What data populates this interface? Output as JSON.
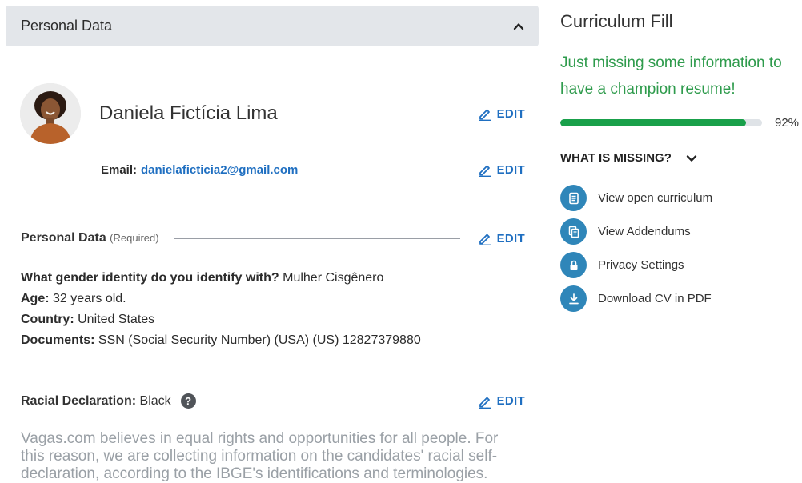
{
  "personal_section": {
    "header": "Personal Data",
    "collapse_icon": "chevron-up-icon"
  },
  "profile": {
    "name": "Daniela Fictícia Lima",
    "edit_label": "EDIT",
    "email_label": "Email:",
    "email_value": "danielaficticia2@gmail.com"
  },
  "personal_data": {
    "title": "Personal Data",
    "required": "(Required)",
    "edit_label": "EDIT",
    "fields": [
      {
        "label": "What gender identity do you identify with?",
        "value": "Mulher Cisgênero"
      },
      {
        "label": "Age:",
        "value": "32 years old."
      },
      {
        "label": "Country:",
        "value": "United States"
      },
      {
        "label": "Documents:",
        "value": "SSN (Social Security Number) (USA) (US) 12827379880"
      }
    ]
  },
  "racial": {
    "label": "Racial Declaration:",
    "value": "Black",
    "help": "?",
    "edit_label": "EDIT",
    "description": "Vagas.com believes in equal rights and opportunities for all people. For this reason, we are collecting information on the candidates' racial self-declaration, according to the IBGE's identifications and terminologies."
  },
  "curriculum": {
    "title": "Curriculum Fill",
    "message": "Just missing some information to have a champion resume!",
    "progress_value": 92,
    "progress_text": "92%",
    "missing_label": "WHAT IS MISSING?",
    "actions": [
      {
        "label": "View open curriculum",
        "icon": "document-icon"
      },
      {
        "label": "View Addendums",
        "icon": "addendum-icon"
      },
      {
        "label": "Privacy Settings",
        "icon": "lock-icon"
      },
      {
        "label": "Download CV in PDF",
        "icon": "download-icon"
      }
    ]
  },
  "colors": {
    "accent": "#1f6fc1",
    "success": "#19a04a",
    "icon_bg": "#2f86b9"
  }
}
